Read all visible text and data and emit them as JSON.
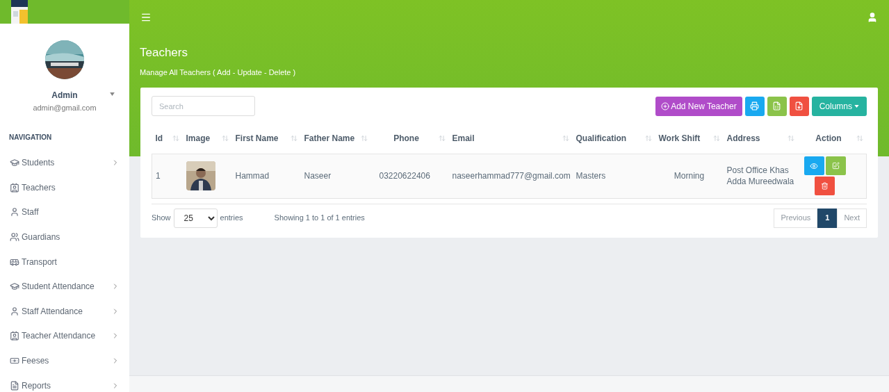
{
  "user": {
    "name": "Admin",
    "email": "admin@gmail.com"
  },
  "sidebar": {
    "heading": "NAVIGATION",
    "items": [
      {
        "label": "Students",
        "kind": "student",
        "expandable": true
      },
      {
        "label": "Teachers",
        "kind": "teacher",
        "expandable": false
      },
      {
        "label": "Staff",
        "kind": "person",
        "expandable": false
      },
      {
        "label": "Guardians",
        "kind": "group",
        "expandable": false
      },
      {
        "label": "Transport",
        "kind": "bus",
        "expandable": false
      },
      {
        "label": "Student Attendance",
        "kind": "student",
        "expandable": true
      },
      {
        "label": "Staff Attendance",
        "kind": "person",
        "expandable": true
      },
      {
        "label": "Teacher Attendance",
        "kind": "teacher",
        "expandable": true
      },
      {
        "label": "Feeses",
        "kind": "money",
        "expandable": true
      },
      {
        "label": "Reports",
        "kind": "report",
        "expandable": true
      }
    ]
  },
  "page": {
    "title": "Teachers",
    "subtitle": "Manage All Teachers ( Add - Update - Delete )"
  },
  "search": {
    "placeholder": "Search"
  },
  "toolbar": {
    "add_label": "Add New Teacher",
    "columns_label": "Columns"
  },
  "table": {
    "columns": [
      "Id",
      "Image",
      "First Name",
      "Father Name",
      "Phone",
      "Email",
      "Qualification",
      "Work Shift",
      "Address",
      "Action"
    ],
    "rows": [
      {
        "id": "1",
        "first_name": "Hammad",
        "father_name": "Naseer",
        "phone": "03220622406",
        "email": "naseerhammad777@gmail.com",
        "qualification": "Masters",
        "work_shift": "Morning",
        "address": "Post Office Khas Adda Mureedwala"
      }
    ]
  },
  "footer": {
    "show": "Show",
    "page_size": "25",
    "entries": "entries",
    "info": "Showing 1 to 1 of 1 entries"
  },
  "pagination": [
    {
      "label": "Previous",
      "kind": "nav",
      "disabled": true,
      "selected": false
    },
    {
      "label": "1",
      "kind": "page",
      "disabled": false,
      "selected": true
    },
    {
      "label": "Next",
      "kind": "nav",
      "disabled": true,
      "selected": false
    }
  ]
}
